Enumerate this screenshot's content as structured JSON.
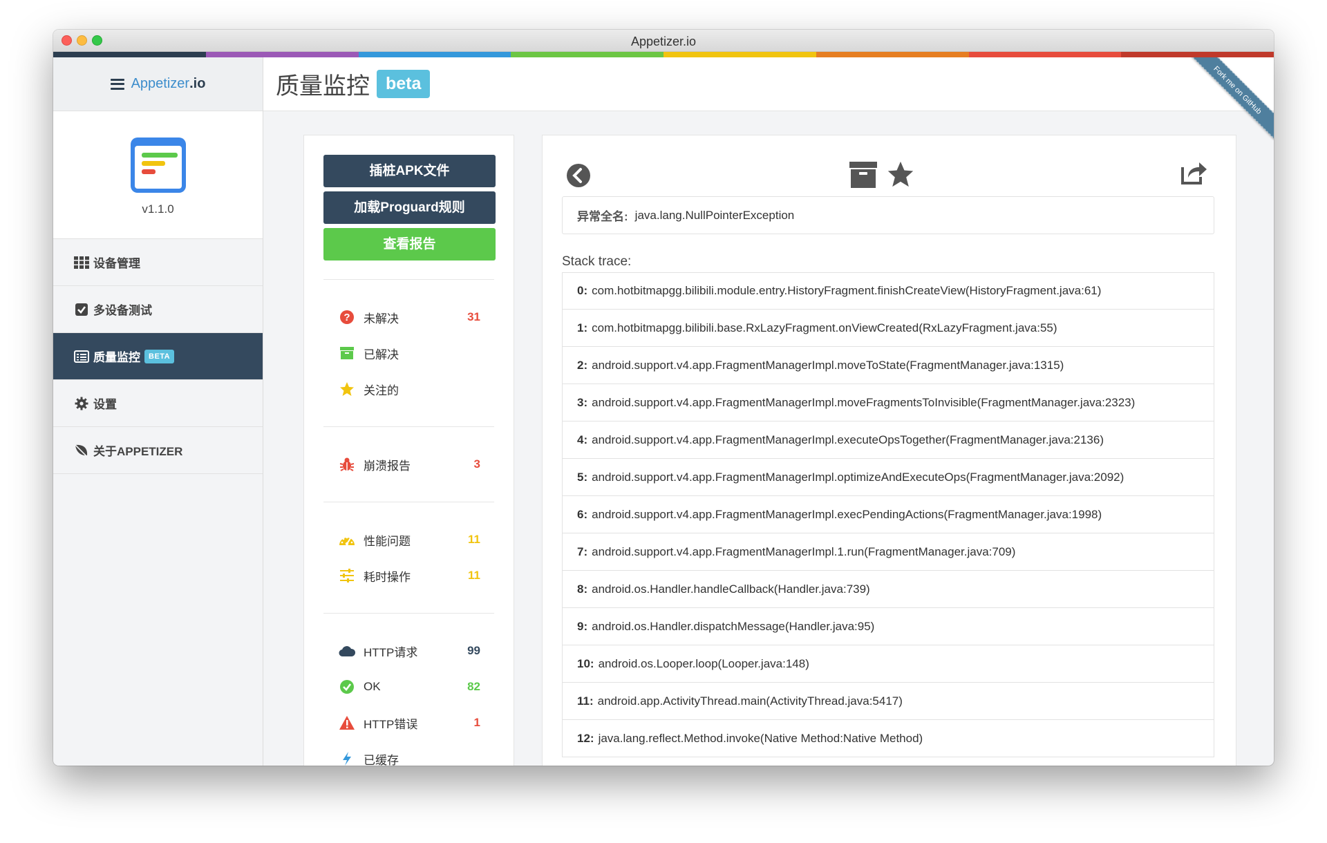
{
  "window": {
    "title": "Appetizer.io"
  },
  "colors": {
    "bar": [
      "#2c3e50",
      "#9b59b6",
      "#3498db",
      "#6cc644",
      "#f1c40f",
      "#e67e22",
      "#e74c3c",
      "#c0392b"
    ],
    "accent": "#3c8dcc",
    "nav_active": "#34495e",
    "beta": "#5bc0de",
    "green": "#5cc94b",
    "red": "#e74c3c",
    "yellow": "#f1c40f"
  },
  "brand": {
    "name": "Appetizer",
    "tld": ".io"
  },
  "app": {
    "version": "v1.1.0"
  },
  "nav": {
    "items": [
      {
        "label": "设备管理",
        "icon": "grid-icon"
      },
      {
        "label": "多设备测试",
        "icon": "checkbox-icon"
      },
      {
        "label": "质量监控",
        "icon": "list-icon",
        "badge": "BETA",
        "active": true
      },
      {
        "label": "设置",
        "icon": "gear-icon"
      },
      {
        "label": "关于APPETIZER",
        "icon": "leaf-icon"
      }
    ]
  },
  "header": {
    "title": "质量监控",
    "badge": "beta",
    "ribbon": "Fork me on GitHub"
  },
  "actions": {
    "instrument_apk": "插桩APK文件",
    "load_proguard": "加载Proguard规则",
    "view_report": "查看报告"
  },
  "filters": {
    "unresolved": {
      "label": "未解决",
      "count": "31",
      "icon": "question-circle-icon"
    },
    "resolved": {
      "label": "已解决",
      "icon": "archive-icon"
    },
    "starred": {
      "label": "关注的",
      "icon": "star-icon"
    },
    "crash": {
      "label": "崩溃报告",
      "count": "3",
      "icon": "bug-icon"
    },
    "performance": {
      "label": "性能问题",
      "count": "11",
      "icon": "dashboard-icon"
    },
    "slow_ops": {
      "label": "耗时操作",
      "count": "11",
      "icon": "sliders-icon"
    },
    "http": {
      "label": "HTTP请求",
      "count": "99",
      "icon": "cloud-icon"
    },
    "ok": {
      "label": "OK",
      "count": "82",
      "icon": "check-circle-icon"
    },
    "http_error": {
      "label": "HTTP错误",
      "count": "1",
      "icon": "warning-icon"
    },
    "cached": {
      "label": "已缓存",
      "icon": "bolt-icon"
    }
  },
  "detail": {
    "exception_label": "异常全名:",
    "exception_name": "java.lang.NullPointerException",
    "stack_title": "Stack trace:",
    "stack": [
      {
        "idx": "0:",
        "text": "com.hotbitmapgg.bilibili.module.entry.HistoryFragment.finishCreateView(HistoryFragment.java:61)"
      },
      {
        "idx": "1:",
        "text": "com.hotbitmapgg.bilibili.base.RxLazyFragment.onViewCreated(RxLazyFragment.java:55)"
      },
      {
        "idx": "2:",
        "text": "android.support.v4.app.FragmentManagerImpl.moveToState(FragmentManager.java:1315)"
      },
      {
        "idx": "3:",
        "text": "android.support.v4.app.FragmentManagerImpl.moveFragmentsToInvisible(FragmentManager.java:2323)"
      },
      {
        "idx": "4:",
        "text": "android.support.v4.app.FragmentManagerImpl.executeOpsTogether(FragmentManager.java:2136)"
      },
      {
        "idx": "5:",
        "text": "android.support.v4.app.FragmentManagerImpl.optimizeAndExecuteOps(FragmentManager.java:2092)"
      },
      {
        "idx": "6:",
        "text": "android.support.v4.app.FragmentManagerImpl.execPendingActions(FragmentManager.java:1998)"
      },
      {
        "idx": "7:",
        "text": "android.support.v4.app.FragmentManagerImpl.1.run(FragmentManager.java:709)"
      },
      {
        "idx": "8:",
        "text": "android.os.Handler.handleCallback(Handler.java:739)"
      },
      {
        "idx": "9:",
        "text": "android.os.Handler.dispatchMessage(Handler.java:95)"
      },
      {
        "idx": "10:",
        "text": "android.os.Looper.loop(Looper.java:148)"
      },
      {
        "idx": "11:",
        "text": "android.app.ActivityThread.main(ActivityThread.java:5417)"
      },
      {
        "idx": "12:",
        "text": "java.lang.reflect.Method.invoke(Native Method:Native Method)"
      }
    ]
  }
}
